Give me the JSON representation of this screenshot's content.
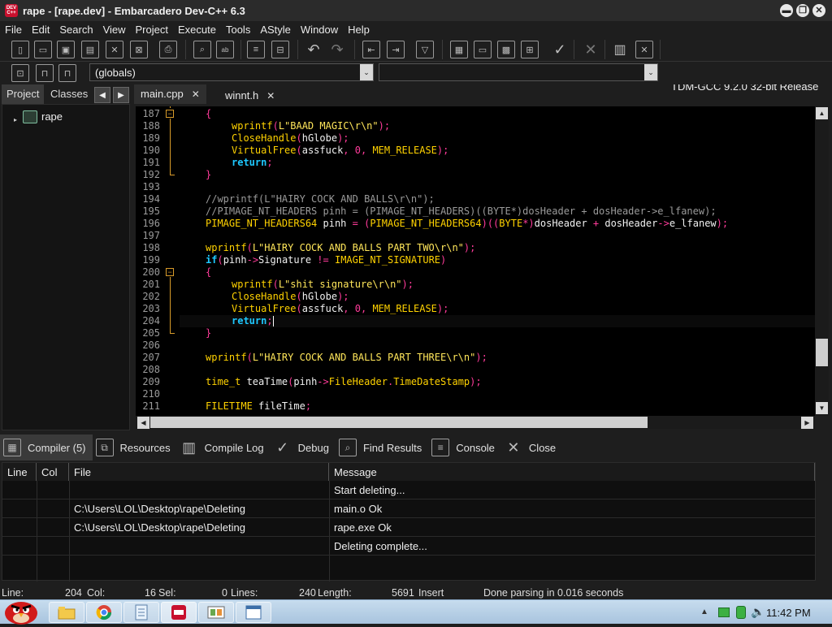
{
  "window": {
    "title": "rape - [rape.dev] - Embarcadero Dev-C++ 6.3",
    "app_icon_text": "DEV C++",
    "minimize": "▬",
    "restore": "❐",
    "close": "✕"
  },
  "menu": [
    "File",
    "Edit",
    "Search",
    "View",
    "Project",
    "Execute",
    "Tools",
    "AStyle",
    "Window",
    "Help"
  ],
  "toolbar": {
    "compiler": "TDM-GCC 9.2.0 32-bit Release",
    "scope": "(globals)",
    "icons": [
      "new-file-icon",
      "open-icon",
      "save-icon",
      "save-all-icon",
      "close-file-icon",
      "close-all-icon",
      "print-icon",
      "find-icon",
      "replace-icon",
      "goto-icon",
      "toggle-bookmark-icon",
      "undo-icon",
      "redo-icon",
      "new-class-icon",
      "insert-icon",
      "toggle-comment-icon",
      "compile-icon",
      "run-icon",
      "compile-run-icon",
      "rebuild-icon",
      "syntax-check-icon",
      "stop-icon",
      "profile-icon",
      "delete-profile-icon"
    ]
  },
  "left_tabs": {
    "project": "Project",
    "classes": "Classes"
  },
  "project_tree": {
    "root": "rape"
  },
  "editor_tabs": [
    {
      "label": "main.cpp",
      "close": "✕"
    },
    {
      "label": "winnt.h",
      "close": "✕"
    }
  ],
  "code": [
    {
      "n": "187",
      "tokens": [
        [
          "c-sym",
          "{"
        ]
      ]
    },
    {
      "n": "188",
      "tokens": [
        [
          "c-kw",
          "wprintf"
        ],
        [
          "c-sym",
          "("
        ],
        [
          "c-str",
          "L\"BAAD MAGIC\\r\\n\""
        ],
        [
          "c-sym",
          ");"
        ]
      ]
    },
    {
      "n": "189",
      "tokens": [
        [
          "c-kw",
          "CloseHandle"
        ],
        [
          "c-sym",
          "("
        ],
        [
          "c-id",
          "hGlobe"
        ],
        [
          "c-sym",
          ");"
        ]
      ]
    },
    {
      "n": "190",
      "tokens": [
        [
          "c-kw",
          "VirtualFree"
        ],
        [
          "c-sym",
          "("
        ],
        [
          "c-id",
          "assfuck"
        ],
        [
          "c-sym",
          ", "
        ],
        [
          "c-num",
          "0"
        ],
        [
          "c-sym",
          ", "
        ],
        [
          "c-kw",
          "MEM_RELEASE"
        ],
        [
          "c-sym",
          ");"
        ]
      ]
    },
    {
      "n": "191",
      "tokens": [
        [
          "c-kw2",
          "return"
        ],
        [
          "c-sym",
          ";"
        ]
      ]
    },
    {
      "n": "192",
      "tokens": [
        [
          "c-sym",
          "}"
        ]
      ]
    },
    {
      "n": "193",
      "tokens": []
    },
    {
      "n": "194",
      "tokens": [
        [
          "c-cm",
          "//wprintf(L\"HAIRY COCK AND BALLS\\r\\n\");"
        ]
      ]
    },
    {
      "n": "195",
      "tokens": [
        [
          "c-cm",
          "//PIMAGE_NT_HEADERS pinh = (PIMAGE_NT_HEADERS)((BYTE*)dosHeader + dosHeader->e_lfanew);"
        ]
      ]
    },
    {
      "n": "196",
      "tokens": [
        [
          "c-kw",
          "PIMAGE_NT_HEADERS64"
        ],
        [
          "c-id",
          " pinh "
        ],
        [
          "c-sym",
          "= ("
        ],
        [
          "c-kw",
          "PIMAGE_NT_HEADERS64"
        ],
        [
          "c-sym",
          ")(("
        ],
        [
          "c-kw",
          "BYTE"
        ],
        [
          "c-sym",
          "*)"
        ],
        [
          "c-id",
          "dosHeader "
        ],
        [
          "c-sym",
          "+ "
        ],
        [
          "c-id",
          "dosHeader"
        ],
        [
          "c-sym",
          "->"
        ],
        [
          "c-id",
          "e_lfanew"
        ],
        [
          "c-sym",
          ");"
        ]
      ]
    },
    {
      "n": "197",
      "tokens": []
    },
    {
      "n": "198",
      "tokens": [
        [
          "c-kw",
          "wprintf"
        ],
        [
          "c-sym",
          "("
        ],
        [
          "c-str",
          "L\"HAIRY COCK AND BALLS PART TWO\\r\\n\""
        ],
        [
          "c-sym",
          ");"
        ]
      ]
    },
    {
      "n": "199",
      "tokens": [
        [
          "c-kw2",
          "if"
        ],
        [
          "c-sym",
          "("
        ],
        [
          "c-id",
          "pinh"
        ],
        [
          "c-sym",
          "->"
        ],
        [
          "c-id",
          "Signature "
        ],
        [
          "c-sym",
          "!= "
        ],
        [
          "c-kw",
          "IMAGE_NT_SIGNATURE"
        ],
        [
          "c-sym",
          ")"
        ]
      ]
    },
    {
      "n": "200",
      "tokens": [
        [
          "c-sym",
          "{"
        ]
      ]
    },
    {
      "n": "201",
      "tokens": [
        [
          "c-kw",
          "wprintf"
        ],
        [
          "c-sym",
          "("
        ],
        [
          "c-str",
          "L\"shit signature\\r\\n\""
        ],
        [
          "c-sym",
          ");"
        ]
      ]
    },
    {
      "n": "202",
      "tokens": [
        [
          "c-kw",
          "CloseHandle"
        ],
        [
          "c-sym",
          "("
        ],
        [
          "c-id",
          "hGlobe"
        ],
        [
          "c-sym",
          ");"
        ]
      ]
    },
    {
      "n": "203",
      "tokens": [
        [
          "c-kw",
          "VirtualFree"
        ],
        [
          "c-sym",
          "("
        ],
        [
          "c-id",
          "assfuck"
        ],
        [
          "c-sym",
          ", "
        ],
        [
          "c-num",
          "0"
        ],
        [
          "c-sym",
          ", "
        ],
        [
          "c-kw",
          "MEM_RELEASE"
        ],
        [
          "c-sym",
          ");"
        ]
      ]
    },
    {
      "n": "204",
      "tokens": [
        [
          "c-kw2",
          "return"
        ],
        [
          "c-sym",
          ";"
        ]
      ]
    },
    {
      "n": "205",
      "tokens": [
        [
          "c-sym",
          "}"
        ]
      ]
    },
    {
      "n": "206",
      "tokens": []
    },
    {
      "n": "207",
      "tokens": [
        [
          "c-kw",
          "wprintf"
        ],
        [
          "c-sym",
          "("
        ],
        [
          "c-str",
          "L\"HAIRY COCK AND BALLS PART THREE\\r\\n\""
        ],
        [
          "c-sym",
          ");"
        ]
      ]
    },
    {
      "n": "208",
      "tokens": []
    },
    {
      "n": "209",
      "tokens": [
        [
          "c-kw",
          "time_t"
        ],
        [
          "c-id",
          " teaTime"
        ],
        [
          "c-sym",
          "("
        ],
        [
          "c-id",
          "pinh"
        ],
        [
          "c-sym",
          "->"
        ],
        [
          "c-kw",
          "FileHeader"
        ],
        [
          "c-sym",
          "."
        ],
        [
          "c-kw",
          "TimeDateStamp"
        ],
        [
          "c-sym",
          ");"
        ]
      ]
    },
    {
      "n": "210",
      "tokens": []
    },
    {
      "n": "211",
      "tokens": [
        [
          "c-kw",
          "FILETIME"
        ],
        [
          "c-id",
          " fileTime"
        ],
        [
          "c-sym",
          ";"
        ]
      ]
    }
  ],
  "bottom_tabs": [
    {
      "label": "Compiler (5)",
      "icon": "compiler-grid-icon"
    },
    {
      "label": "Resources",
      "icon": "resources-icon"
    },
    {
      "label": "Compile Log",
      "icon": "compile-log-icon"
    },
    {
      "label": "Debug",
      "icon": "debug-check-icon"
    },
    {
      "label": "Find Results",
      "icon": "find-results-icon"
    },
    {
      "label": "Console",
      "icon": "console-icon"
    },
    {
      "label": "Close",
      "icon": "close-x-icon"
    }
  ],
  "results": {
    "headers": [
      "Line",
      "Col",
      "File",
      "Message"
    ],
    "rows": [
      {
        "line": "",
        "col": "",
        "file": "",
        "message": "Start deleting..."
      },
      {
        "line": "",
        "col": "",
        "file": "C:\\Users\\LOL\\Desktop\\rape\\Deleting",
        "message": "main.o Ok"
      },
      {
        "line": "",
        "col": "",
        "file": "C:\\Users\\LOL\\Desktop\\rape\\Deleting",
        "message": "rape.exe Ok"
      },
      {
        "line": "",
        "col": "",
        "file": "",
        "message": "Deleting complete..."
      }
    ]
  },
  "status": {
    "line_label": "Line:",
    "line": "204",
    "col_label": "Col:",
    "col": "16",
    "sel_label": "Sel:",
    "sel": "0",
    "lines_label": "Lines:",
    "lines": "240",
    "length_label": "Length:",
    "length": "5691",
    "mode": "Insert",
    "message": "Done parsing in 0.016 seconds"
  },
  "taskbar": {
    "clock": "11:42 PM",
    "apps": [
      "explorer-icon",
      "chrome-icon",
      "notepad-icon",
      "devcpp-icon",
      "hxd-icon",
      "window-icon"
    ]
  }
}
